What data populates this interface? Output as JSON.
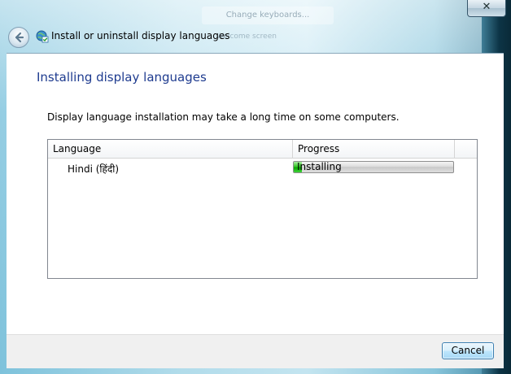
{
  "window": {
    "title": "Install or uninstall display languages",
    "close_label": "✕",
    "background_button_label": "Change keyboards...",
    "background_text": "Welcome screen"
  },
  "main": {
    "heading": "Installing display languages",
    "description": "Display language installation may take a long time on some computers.",
    "list": {
      "columns": [
        "Language",
        "Progress"
      ],
      "rows": [
        {
          "language": "Hindi (हिंदी)",
          "status": "Installing",
          "progress_fraction": 0.05
        }
      ]
    }
  },
  "footer": {
    "cancel_label": "Cancel"
  },
  "colors": {
    "heading": "#1e3b8f",
    "progress_fill": "#08a700",
    "button_border": "#3c7fb1"
  },
  "icons": {
    "back": "back-arrow-icon",
    "title": "globe-check-icon",
    "close": "close-icon"
  }
}
